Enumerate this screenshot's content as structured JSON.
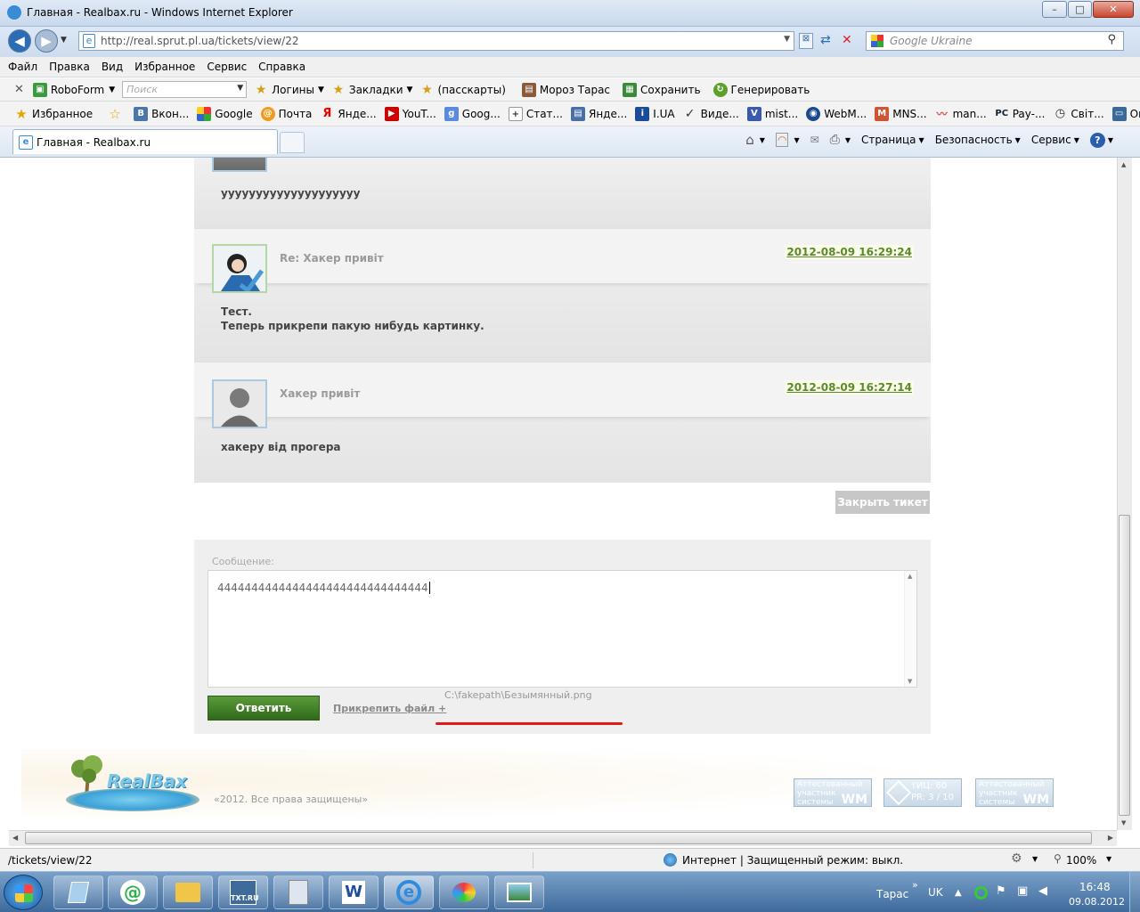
{
  "window": {
    "title": "Главная - Realbax.ru - Windows Internet Explorer",
    "min": "–",
    "max": "□",
    "close": "✕"
  },
  "address": {
    "url": "http://real.sprut.pl.ua/tickets/view/22",
    "search_placeholder": "Google Ukraine"
  },
  "menu": [
    "Файл",
    "Правка",
    "Вид",
    "Избранное",
    "Сервис",
    "Справка"
  ],
  "roboform": {
    "name": "RoboForm",
    "search_placeholder": "Поиск",
    "items": [
      "Логины",
      "Закладки",
      "(пасскарты)",
      "Мороз Тарас",
      "Сохранить",
      "Генерировать"
    ]
  },
  "favorites": {
    "label": "Избранное",
    "items": [
      "Вкон...",
      "Google",
      "Почта",
      "Янде...",
      "YouT...",
      "Goog...",
      "Стат...",
      "Янде...",
      "I.UA",
      "Виде...",
      "mist...",
      "WebM...",
      "MNS...",
      "man...",
      "Pay-...",
      "Світ...",
      "Онла..."
    ]
  },
  "tab": {
    "title": "Главная - Realbax.ru"
  },
  "commandbar": [
    "Страница",
    "Безопасность",
    "Сервис"
  ],
  "colors": {
    "accent_green": "#5a8a2c",
    "button_green": "#3d7d24",
    "underline_red": "#e21a1a"
  },
  "ticket": {
    "messages": [
      {
        "title": "",
        "date": "",
        "body": [
          "уууууууууууууууууууу"
        ]
      },
      {
        "title": "Re: Хакер привіт",
        "date": "2012-08-09 16:29:24",
        "body": [
          "Тест.",
          "Теперь прикрепи пакую нибудь картинку."
        ]
      },
      {
        "title": "Хакер привіт",
        "date": "2012-08-09 16:27:14",
        "body": [
          "хакеру від прогера"
        ]
      }
    ],
    "close_button": "Закрыть тикет",
    "reply": {
      "label": "Сообщение:",
      "value": "4444444444444444444444444444444",
      "submit": "Ответить",
      "attach": "Прикрепить файл +",
      "attached_path": "C:\\fakepath\\Безымянный.png"
    }
  },
  "footer": {
    "logo": "RealBax",
    "copyright": "«2012. Все права защищены»",
    "badges": [
      {
        "line1": "Аттестованный",
        "line2": "участник системы",
        "mark": "WM"
      },
      {
        "line1": "тИЦ: 60",
        "line2": "PR: 3 / 10",
        "mark": ""
      },
      {
        "line1": "Аттестованный",
        "line2": "участник системы",
        "mark": "WM"
      }
    ]
  },
  "status": {
    "path": "/tickets/view/22",
    "zone": "Интернет | Защищенный режим: выкл.",
    "zoom": "100%"
  },
  "taskbar": {
    "lang_user": "Тарас",
    "lang": "UK",
    "time": "16:48",
    "date": "09.08.2012",
    "apps": [
      "mail",
      "explorer",
      "txt.ru",
      "calculator",
      "word",
      "ie",
      "paint",
      "photos"
    ],
    "txt_label": "TXT.RU",
    "word_label": "W"
  }
}
